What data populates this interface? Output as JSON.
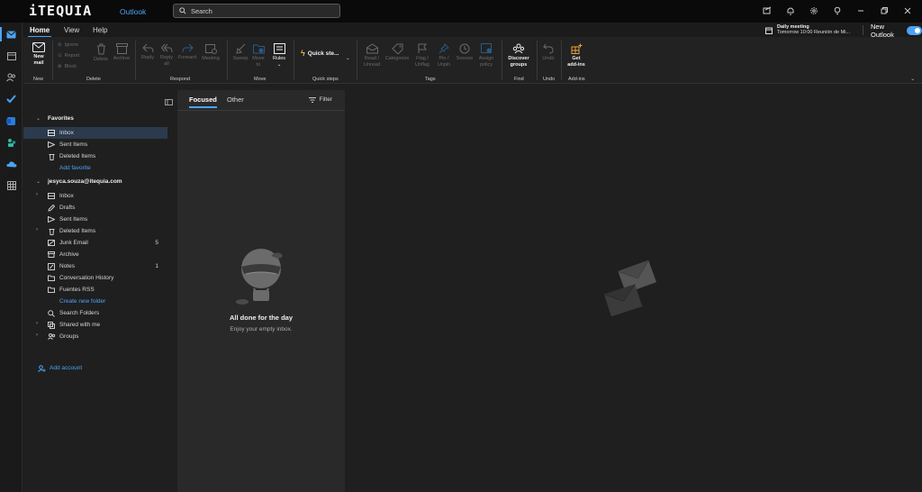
{
  "titlebar": {
    "brand": "iTEQUIA",
    "app_name": "Outlook",
    "search_placeholder": "Search"
  },
  "tabs": [
    {
      "label": "Home"
    },
    {
      "label": "View"
    },
    {
      "label": "Help"
    }
  ],
  "meeting": {
    "title": "Daily meeting",
    "detail": "Tomorrow 10:00 Reunión de Mi..."
  },
  "new_outlook": {
    "label": "New Outlook",
    "enabled": true
  },
  "ribbon": {
    "new_mail": "New\nmail",
    "ignore": "Ignore",
    "report": "Report",
    "block": "Block",
    "delete": "Delete",
    "archive": "Archive",
    "reply": "Reply",
    "reply_all": "Reply\nall",
    "forward": "Forward",
    "meeting": "Meeting",
    "sweep": "Sweep",
    "move_to": "Move\nto",
    "rules": "Rules",
    "quick_steps": "Quick ste...",
    "read_unread": "Read /\nUnread",
    "categorize": "Categorize",
    "flag": "Flag /\nUnflag",
    "pin": "Pin /\nUnpin",
    "snooze": "Snooze",
    "assign_policy": "Assign\npolicy",
    "discover_groups": "Discover\ngroups",
    "undo": "Undo",
    "get_addins": "Get\nadd-ins",
    "groups": {
      "new": "New",
      "delete": "Delete",
      "respond": "Respond",
      "move": "Move",
      "quick_steps": "Quick steps",
      "tags": "Tags",
      "find": "Find",
      "undo": "Undo",
      "addins": "Add-ins"
    }
  },
  "nav": {
    "favorites_label": "Favorites",
    "favorites": [
      {
        "label": "Inbox",
        "icon": "inbox-icon",
        "selected": true
      },
      {
        "label": "Sent Items",
        "icon": "send-icon"
      },
      {
        "label": "Deleted Items",
        "icon": "trash-icon"
      }
    ],
    "add_favorite": "Add favorite",
    "account": "jesyca.souza@itequia.com",
    "folders": [
      {
        "label": "Inbox",
        "icon": "inbox-icon",
        "chevron": true
      },
      {
        "label": "Drafts",
        "icon": "pencil-icon"
      },
      {
        "label": "Sent Items",
        "icon": "send-icon"
      },
      {
        "label": "Deleted Items",
        "icon": "trash-icon",
        "chevron": true
      },
      {
        "label": "Junk Email",
        "icon": "junk-icon",
        "count": "5"
      },
      {
        "label": "Archive",
        "icon": "archive-icon"
      },
      {
        "label": "Notes",
        "icon": "note-icon",
        "count": "1"
      },
      {
        "label": "Conversation History",
        "icon": "folder-icon"
      },
      {
        "label": "Fuentes RSS",
        "icon": "folder-icon"
      }
    ],
    "create_folder": "Create new folder",
    "search_folders": "Search Folders",
    "shared": "Shared with me",
    "groups": "Groups",
    "add_account": "Add account"
  },
  "list": {
    "tab_focused": "Focused",
    "tab_other": "Other",
    "filter": "Filter",
    "empty_title": "All done for the day",
    "empty_subtitle": "Enjoy your empty inbox."
  },
  "colors": {
    "accent": "#4ca3f5",
    "background": "#1f1f1f",
    "pane": "#292929"
  }
}
